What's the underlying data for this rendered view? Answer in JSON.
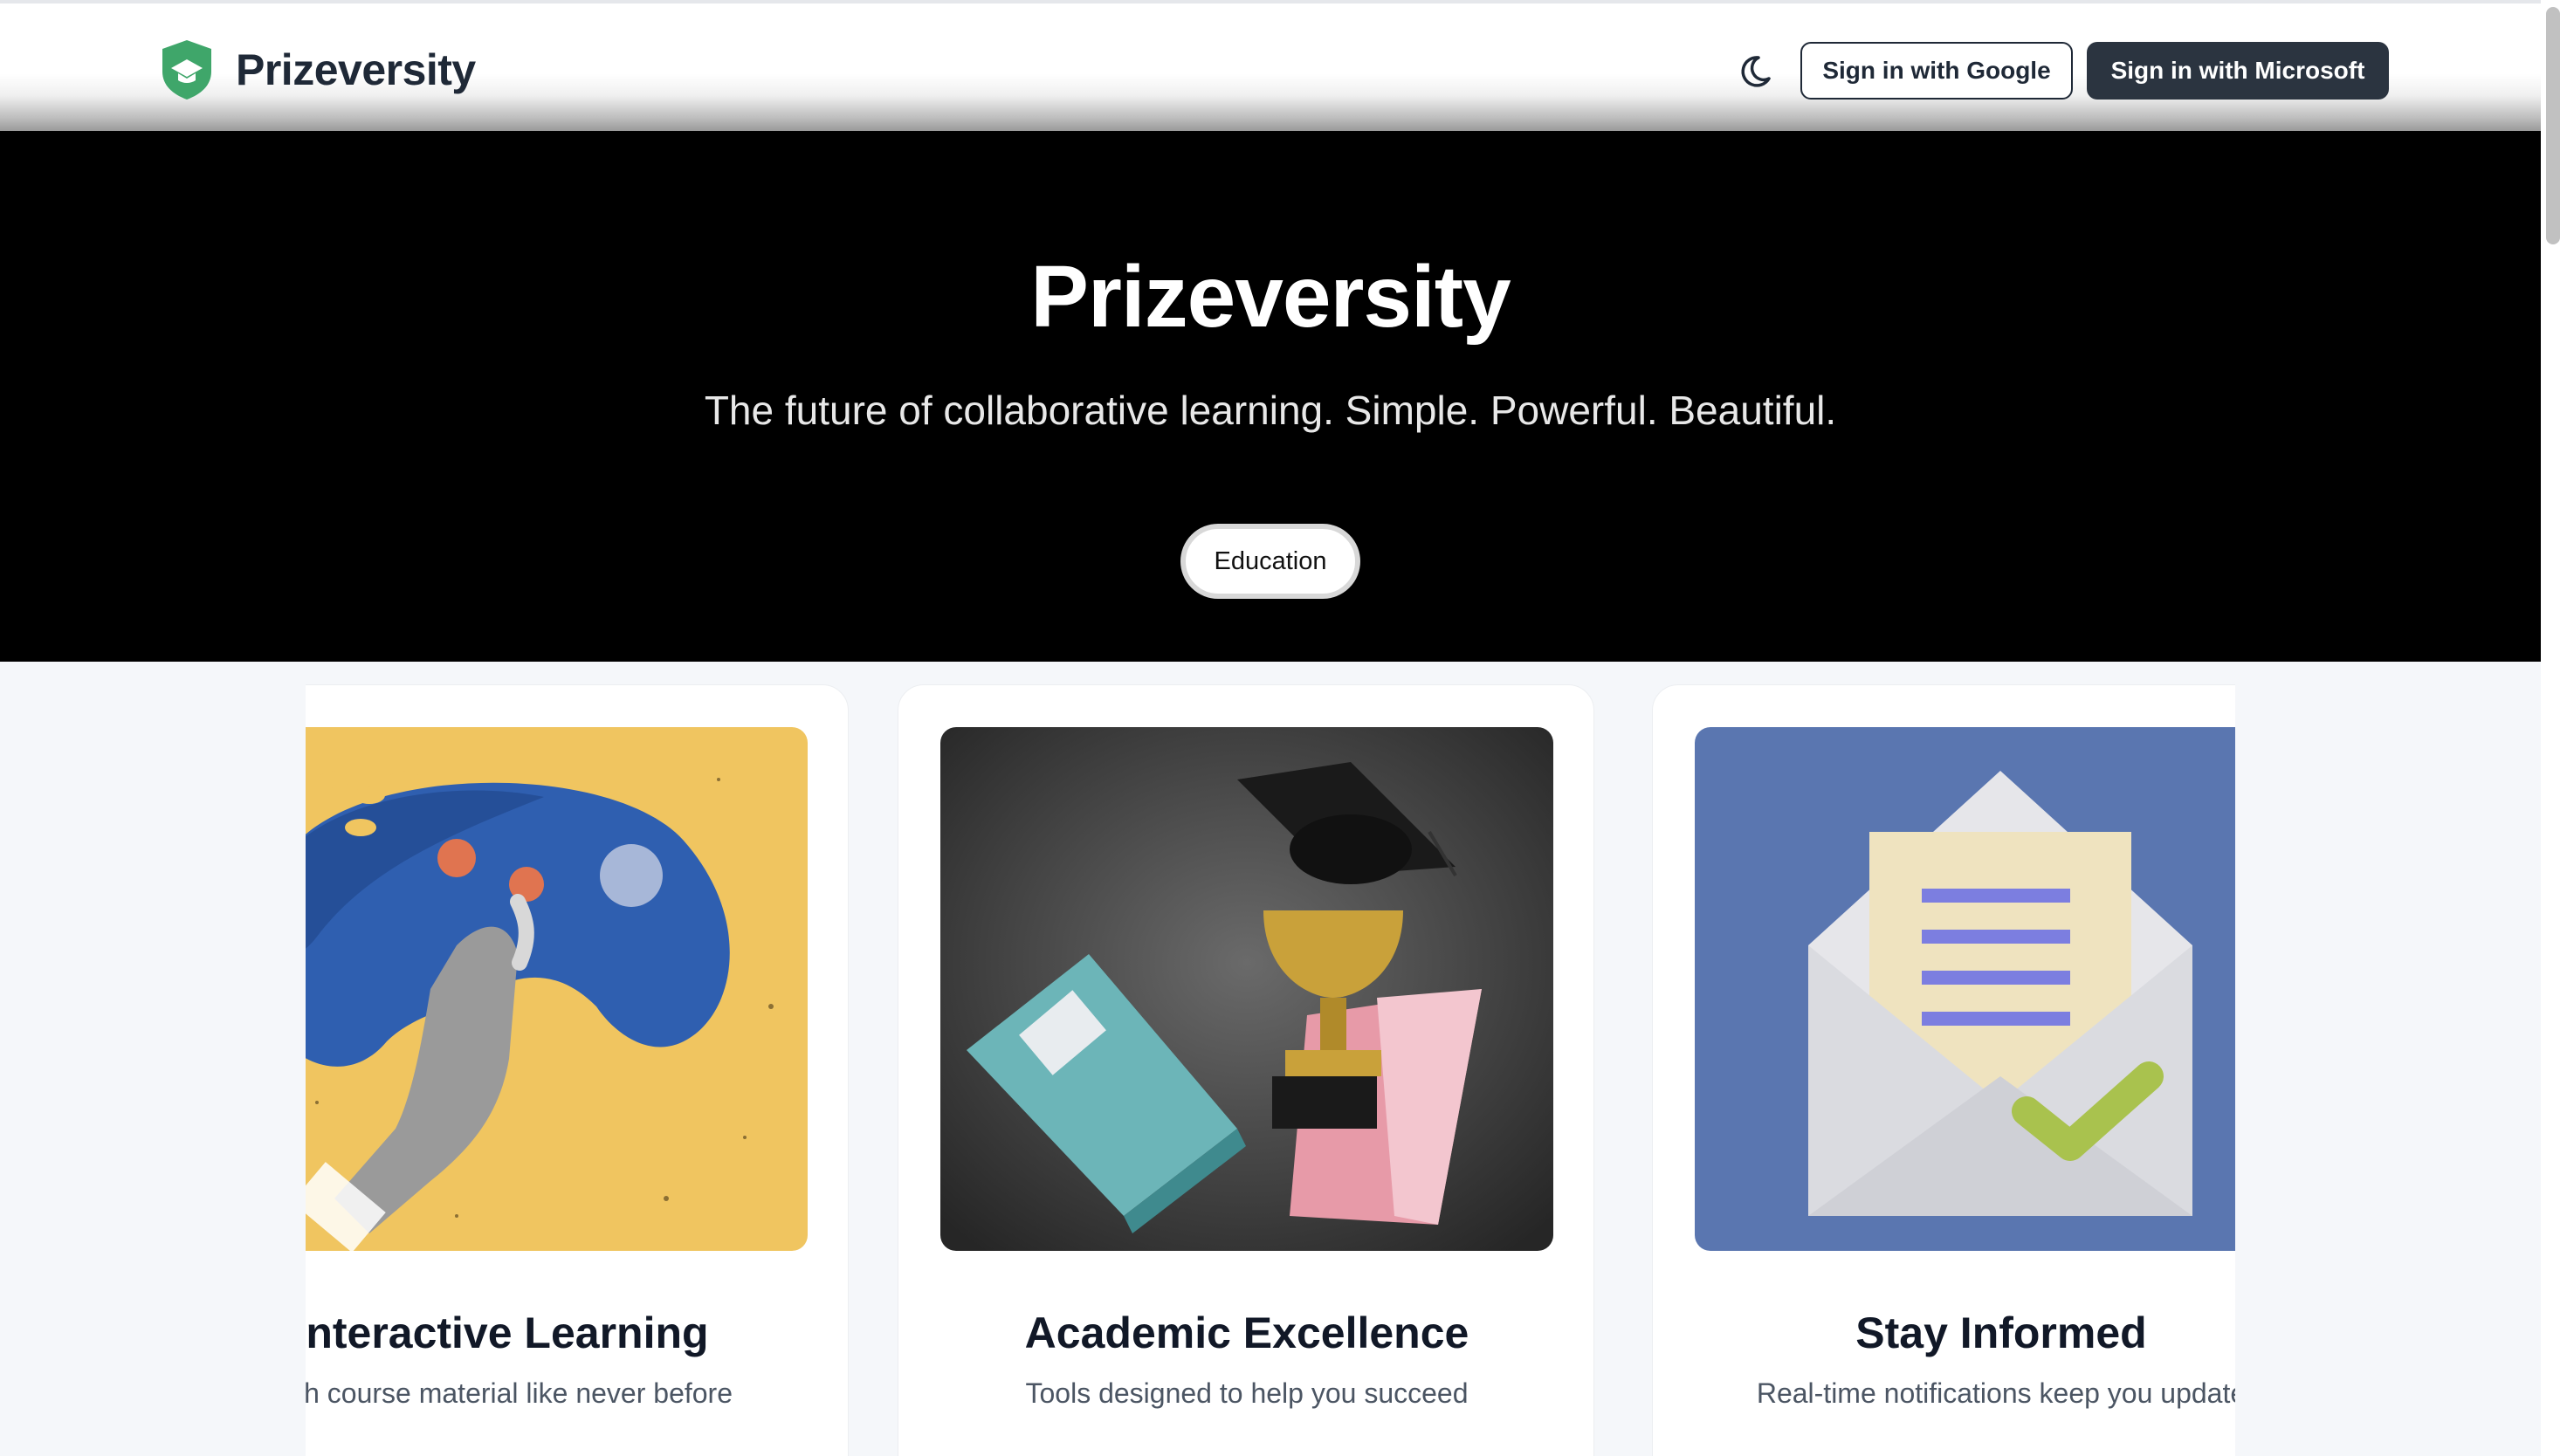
{
  "header": {
    "brand": "Prizeversity",
    "theme_icon": "moon-icon",
    "google_button": "Sign in with Google",
    "microsoft_button": "Sign in with Microsoft"
  },
  "hero": {
    "title": "Prizeversity",
    "subtitle": "The future of collaborative learning. Simple. Powerful. Beautiful.",
    "pill": "Education"
  },
  "cards": [
    {
      "title": "Interactive Learning",
      "desc": "with course material like never before",
      "image": "game-controller-illustration"
    },
    {
      "title": "Academic Excellence",
      "desc": "Tools designed to help you succeed",
      "image": "trophy-books-illustration"
    },
    {
      "title": "Stay Informed",
      "desc": "Real-time notifications keep you update",
      "image": "envelope-checkmark-illustration"
    }
  ],
  "colors": {
    "logo_green": "#3fa66a",
    "hero_bg": "#000000",
    "primary_button": "#2b3440"
  }
}
